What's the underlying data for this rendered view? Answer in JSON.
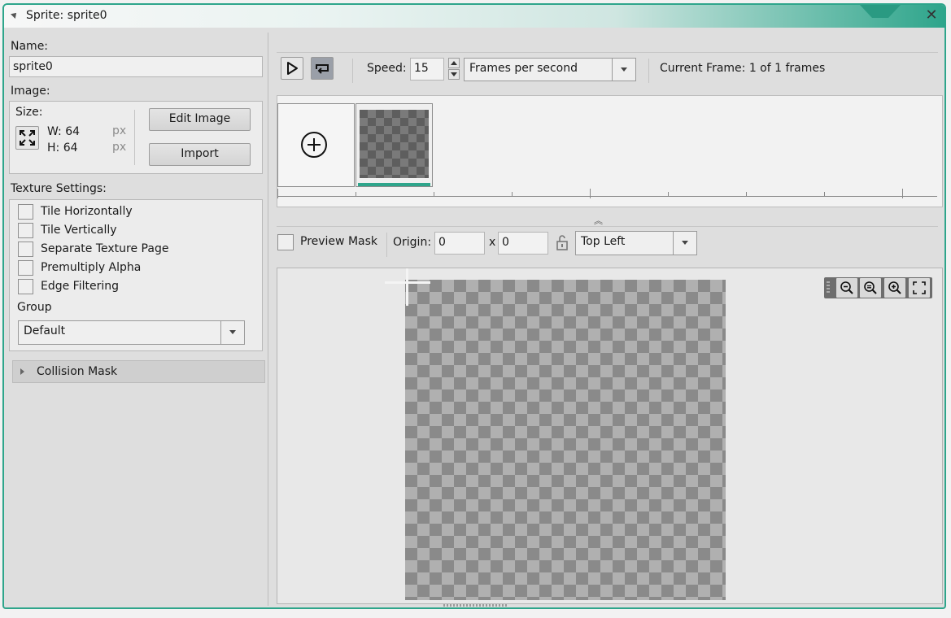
{
  "window": {
    "title": "Sprite: sprite0"
  },
  "left": {
    "name_label": "Name:",
    "name_value": "sprite0",
    "image_label": "Image:",
    "size_label": "Size:",
    "width_text": "W: 64",
    "height_text": "H: 64",
    "unit_w": "px",
    "unit_h": "px",
    "edit_image_label": "Edit Image",
    "import_label": "Import",
    "texture_label": "Texture Settings:",
    "checkboxes": [
      {
        "label": "Tile Horizontally",
        "checked": false
      },
      {
        "label": "Tile Vertically",
        "checked": false
      },
      {
        "label": "Separate Texture Page",
        "checked": false
      },
      {
        "label": "Premultiply Alpha",
        "checked": false
      },
      {
        "label": "Edge Filtering",
        "checked": false
      }
    ],
    "group_label": "Group",
    "group_value": "Default",
    "collision_label": "Collision Mask"
  },
  "playback": {
    "speed_label": "Speed:",
    "speed_value": "15",
    "speed_unit": "Frames per second",
    "current_frame": "Current Frame: 1 of 1 frames"
  },
  "preview": {
    "preview_mask_label": "Preview Mask",
    "origin_label": "Origin:",
    "origin_x": "0",
    "origin_sep": "x",
    "origin_y": "0",
    "origin_preset": "Top Left"
  },
  "colors": {
    "accent": "#2ea58b"
  },
  "icons": [
    "play-icon",
    "loop-icon",
    "add-frame-icon",
    "lock-open-icon",
    "zoom-out-icon",
    "zoom-reset-icon",
    "zoom-in-icon",
    "fit-screen-icon",
    "resize-icon",
    "close-icon"
  ]
}
